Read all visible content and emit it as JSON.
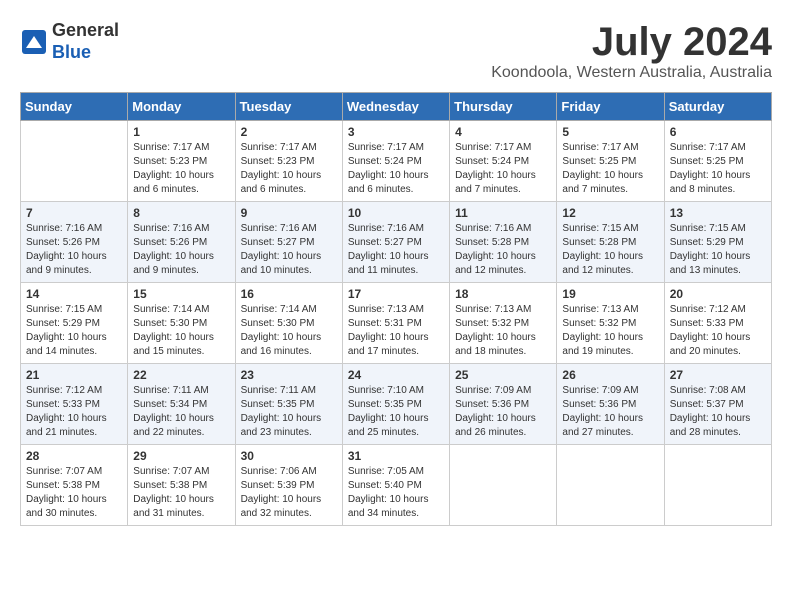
{
  "header": {
    "logo_line1": "General",
    "logo_line2": "Blue",
    "month": "July 2024",
    "location": "Koondoola, Western Australia, Australia"
  },
  "days_of_week": [
    "Sunday",
    "Monday",
    "Tuesday",
    "Wednesday",
    "Thursday",
    "Friday",
    "Saturday"
  ],
  "weeks": [
    [
      {
        "day": "",
        "empty": true
      },
      {
        "day": "1",
        "sunrise": "7:17 AM",
        "sunset": "5:23 PM",
        "daylight": "10 hours and 6 minutes."
      },
      {
        "day": "2",
        "sunrise": "7:17 AM",
        "sunset": "5:23 PM",
        "daylight": "10 hours and 6 minutes."
      },
      {
        "day": "3",
        "sunrise": "7:17 AM",
        "sunset": "5:24 PM",
        "daylight": "10 hours and 6 minutes."
      },
      {
        "day": "4",
        "sunrise": "7:17 AM",
        "sunset": "5:24 PM",
        "daylight": "10 hours and 7 minutes."
      },
      {
        "day": "5",
        "sunrise": "7:17 AM",
        "sunset": "5:25 PM",
        "daylight": "10 hours and 7 minutes."
      },
      {
        "day": "6",
        "sunrise": "7:17 AM",
        "sunset": "5:25 PM",
        "daylight": "10 hours and 8 minutes."
      }
    ],
    [
      {
        "day": "7",
        "sunrise": "7:16 AM",
        "sunset": "5:26 PM",
        "daylight": "10 hours and 9 minutes."
      },
      {
        "day": "8",
        "sunrise": "7:16 AM",
        "sunset": "5:26 PM",
        "daylight": "10 hours and 9 minutes."
      },
      {
        "day": "9",
        "sunrise": "7:16 AM",
        "sunset": "5:27 PM",
        "daylight": "10 hours and 10 minutes."
      },
      {
        "day": "10",
        "sunrise": "7:16 AM",
        "sunset": "5:27 PM",
        "daylight": "10 hours and 11 minutes."
      },
      {
        "day": "11",
        "sunrise": "7:16 AM",
        "sunset": "5:28 PM",
        "daylight": "10 hours and 12 minutes."
      },
      {
        "day": "12",
        "sunrise": "7:15 AM",
        "sunset": "5:28 PM",
        "daylight": "10 hours and 12 minutes."
      },
      {
        "day": "13",
        "sunrise": "7:15 AM",
        "sunset": "5:29 PM",
        "daylight": "10 hours and 13 minutes."
      }
    ],
    [
      {
        "day": "14",
        "sunrise": "7:15 AM",
        "sunset": "5:29 PM",
        "daylight": "10 hours and 14 minutes."
      },
      {
        "day": "15",
        "sunrise": "7:14 AM",
        "sunset": "5:30 PM",
        "daylight": "10 hours and 15 minutes."
      },
      {
        "day": "16",
        "sunrise": "7:14 AM",
        "sunset": "5:30 PM",
        "daylight": "10 hours and 16 minutes."
      },
      {
        "day": "17",
        "sunrise": "7:13 AM",
        "sunset": "5:31 PM",
        "daylight": "10 hours and 17 minutes."
      },
      {
        "day": "18",
        "sunrise": "7:13 AM",
        "sunset": "5:32 PM",
        "daylight": "10 hours and 18 minutes."
      },
      {
        "day": "19",
        "sunrise": "7:13 AM",
        "sunset": "5:32 PM",
        "daylight": "10 hours and 19 minutes."
      },
      {
        "day": "20",
        "sunrise": "7:12 AM",
        "sunset": "5:33 PM",
        "daylight": "10 hours and 20 minutes."
      }
    ],
    [
      {
        "day": "21",
        "sunrise": "7:12 AM",
        "sunset": "5:33 PM",
        "daylight": "10 hours and 21 minutes."
      },
      {
        "day": "22",
        "sunrise": "7:11 AM",
        "sunset": "5:34 PM",
        "daylight": "10 hours and 22 minutes."
      },
      {
        "day": "23",
        "sunrise": "7:11 AM",
        "sunset": "5:35 PM",
        "daylight": "10 hours and 23 minutes."
      },
      {
        "day": "24",
        "sunrise": "7:10 AM",
        "sunset": "5:35 PM",
        "daylight": "10 hours and 25 minutes."
      },
      {
        "day": "25",
        "sunrise": "7:09 AM",
        "sunset": "5:36 PM",
        "daylight": "10 hours and 26 minutes."
      },
      {
        "day": "26",
        "sunrise": "7:09 AM",
        "sunset": "5:36 PM",
        "daylight": "10 hours and 27 minutes."
      },
      {
        "day": "27",
        "sunrise": "7:08 AM",
        "sunset": "5:37 PM",
        "daylight": "10 hours and 28 minutes."
      }
    ],
    [
      {
        "day": "28",
        "sunrise": "7:07 AM",
        "sunset": "5:38 PM",
        "daylight": "10 hours and 30 minutes."
      },
      {
        "day": "29",
        "sunrise": "7:07 AM",
        "sunset": "5:38 PM",
        "daylight": "10 hours and 31 minutes."
      },
      {
        "day": "30",
        "sunrise": "7:06 AM",
        "sunset": "5:39 PM",
        "daylight": "10 hours and 32 minutes."
      },
      {
        "day": "31",
        "sunrise": "7:05 AM",
        "sunset": "5:40 PM",
        "daylight": "10 hours and 34 minutes."
      },
      {
        "day": "",
        "empty": true
      },
      {
        "day": "",
        "empty": true
      },
      {
        "day": "",
        "empty": true
      }
    ]
  ]
}
